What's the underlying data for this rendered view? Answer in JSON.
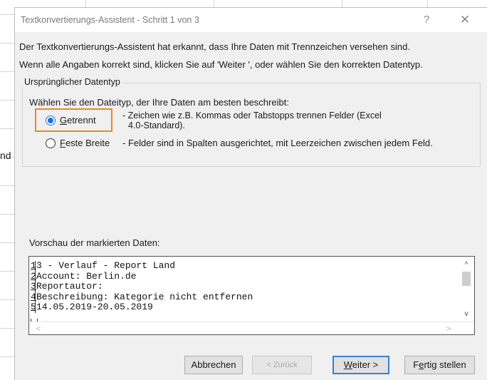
{
  "background": {
    "cell_fragment": "nd"
  },
  "dialog": {
    "title": "Textkonvertierungs-Assistent - Schritt 1 von 3",
    "help_label": "?",
    "close_label": "✕",
    "intro_line1": "Der Textkonvertierungs-Assistent hat erkannt, dass Ihre Daten mit Trennzeichen versehen sind.",
    "intro_line2": "Wenn alle Angaben korrekt sind, klicken Sie auf 'Weiter ', oder wählen Sie den korrekten Datentyp.",
    "group": {
      "legend": "Ursprünglicher Datentyp",
      "prompt": "Wählen Sie den Dateityp, der Ihre Daten am besten beschreibt:",
      "options": [
        {
          "label_access": "G",
          "label_rest": "etrennt",
          "checked": true,
          "desc_line1": "- Zeichen wie z.B. Kommas oder Tabstopps trennen Felder (Excel",
          "desc_line2": "4.0-Standard)."
        },
        {
          "label_access": "F",
          "label_rest": "este Breite",
          "checked": false,
          "desc_line1": "- Felder sind in Spalten ausgerichtet, mit Leerzeichen zwischen jedem Feld."
        }
      ]
    },
    "preview": {
      "label": "Vorschau der markierten Daten:",
      "lines": [
        {
          "num": "1",
          "text": "3 - Verlauf - Report Land"
        },
        {
          "num": "2",
          "text": "Account: Berlin.de"
        },
        {
          "num": "3",
          "text": "Reportautor:"
        },
        {
          "num": "4",
          "text": "Beschreibung: Kategorie nicht entfernen"
        },
        {
          "num": "5",
          "text": "14.05.2019-20.05.2019"
        }
      ],
      "scroll_up": "^",
      "scroll_down": "v",
      "scroll_left": "<",
      "scroll_right": ">"
    },
    "buttons": {
      "cancel": "Abbrechen",
      "back": "< Zurück",
      "next_access": "W",
      "next_rest": "eiter >",
      "finish_pre": "F",
      "finish_access": "e",
      "finish_rest": "rtig stellen"
    }
  },
  "colors": {
    "highlight_orange": "#e8891f",
    "radio_blue": "#1f6fd1",
    "primary_border": "#3c7fd0"
  }
}
